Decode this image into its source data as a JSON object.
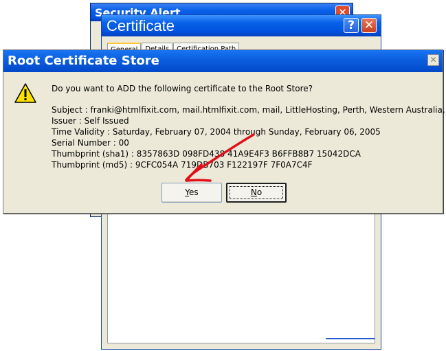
{
  "security_alert": {
    "title": "Security Alert",
    "close_label": "✕"
  },
  "certificate": {
    "title": "Certificate",
    "help_label": "?",
    "close_label": "✕",
    "tabs": [
      "General",
      "Details",
      "Certification Path"
    ]
  },
  "dialog": {
    "title": "Root Certificate Store",
    "close_label": "✕",
    "question": "Do you want to ADD the following certificate to the Root Store?",
    "lines": [
      "Subject : franki@htmlfixit.com, mail.htmlfixit.com, mail, LittleHosting, Perth, Western Australia, AU",
      "Issuer : Self Issued",
      "Time Validity : Saturday, February 07, 2004 through Sunday, February 06, 2005",
      "Serial Number : 00",
      "Thumbprint (sha1) : 8357863D 098FD438 41A9E4F3 B6FFB8B7 15042DCA",
      "Thumbprint (md5) : 9CFC054A 719DB703 F122197F 7F0A7C4F"
    ],
    "yes_label_mnemonic": "Y",
    "yes_label_rest": "es",
    "no_label_mnemonic": "N",
    "no_label_rest": "o"
  },
  "icons": {
    "warning": "warning-icon",
    "annotation": "red-arrow-annotation"
  },
  "colors": {
    "title_blue": "#0054e3",
    "arrow_red": "#e0101a",
    "dialog_bg": "#ece9d8"
  }
}
